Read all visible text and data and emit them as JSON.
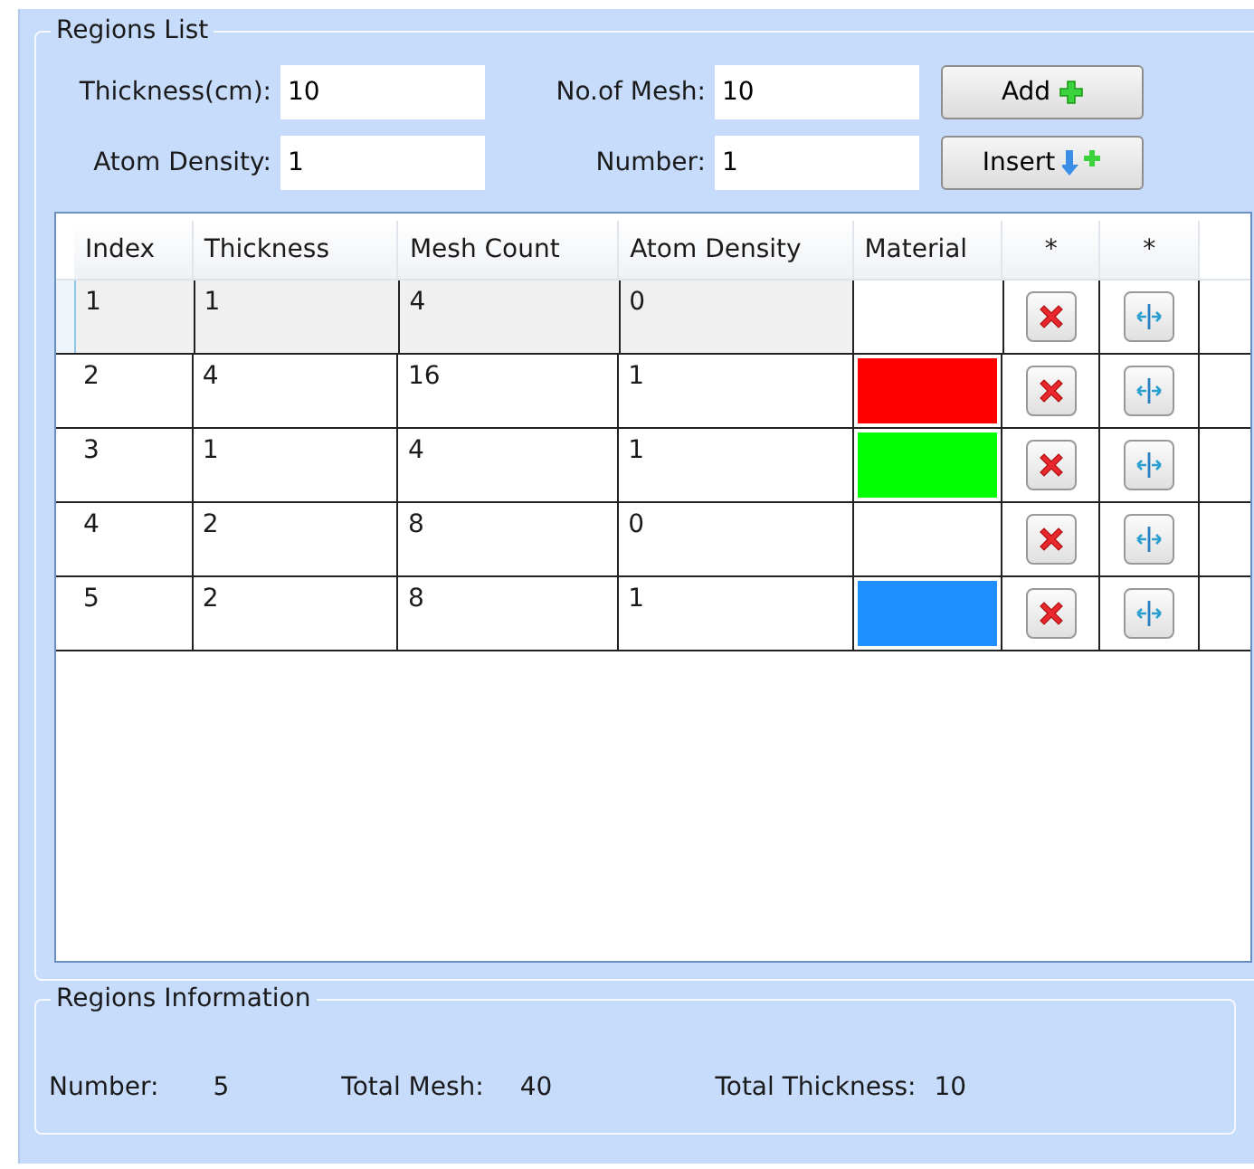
{
  "regions_list": {
    "title": "Regions List",
    "fields": [
      {
        "label": "Thickness(cm):",
        "value": "10"
      },
      {
        "label": "No.of Mesh:",
        "value": "10"
      },
      {
        "label": "Atom Density:",
        "value": "1"
      },
      {
        "label": "Number:",
        "value": "1"
      }
    ],
    "buttons": [
      {
        "label": "Add",
        "kind": "add"
      },
      {
        "label": "Insert",
        "kind": "insert"
      }
    ]
  },
  "table": {
    "columns": [
      "Index",
      "Thickness",
      "Mesh Count",
      "Atom Density",
      "Material",
      "*",
      "*"
    ],
    "rows": [
      {
        "cells": [
          "1",
          "1",
          "4",
          "0"
        ],
        "selected": true
      },
      {
        "cells": [
          "2",
          "4",
          "16",
          "1"
        ],
        "color": "#ff0000",
        "selected": false
      },
      {
        "cells": [
          "3",
          "1",
          "4",
          "1"
        ],
        "color": "#00ff00",
        "selected": false
      },
      {
        "cells": [
          "4",
          "2",
          "8",
          "0"
        ],
        "selected": false
      },
      {
        "cells": [
          "5",
          "2",
          "8",
          "1"
        ],
        "color": "#1e90ff",
        "selected": false
      }
    ]
  },
  "regions_information": {
    "title": "Regions Information",
    "items": [
      {
        "label": "Number:",
        "value": "5"
      },
      {
        "label": "Total Mesh:",
        "value": "40"
      },
      {
        "label": "Total Thickness:",
        "value": "10"
      }
    ]
  }
}
